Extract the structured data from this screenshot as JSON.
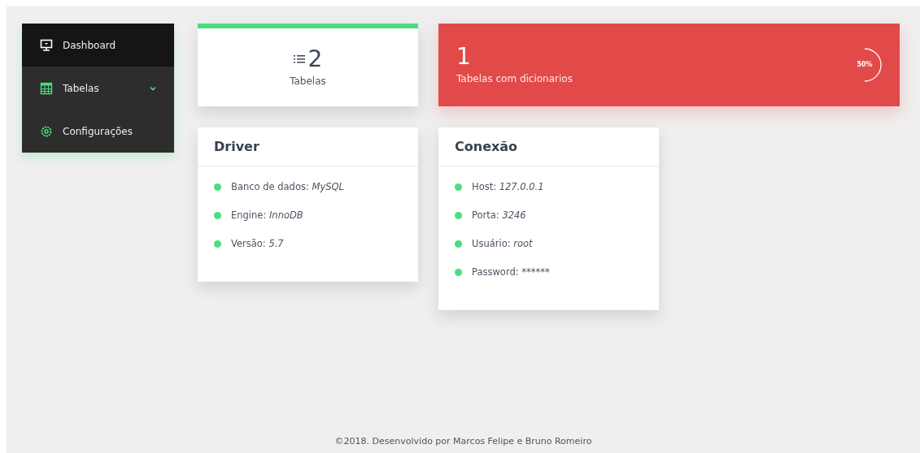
{
  "sidebar": {
    "items": [
      {
        "label": "Dashboard",
        "selected": true
      },
      {
        "label": "Tabelas",
        "selected": false,
        "expanded": true
      },
      {
        "label": "Configurações",
        "selected": false
      }
    ]
  },
  "stats": [
    {
      "kind": "count",
      "value": "2",
      "label": "Tabelas"
    },
    {
      "kind": "progress",
      "value": "1",
      "label": "Tabelas com dicionarios",
      "reading": "50%"
    }
  ],
  "panels": [
    {
      "title": "Driver",
      "items": [
        {
          "label": "Banco de dados:",
          "value": "MySQL"
        },
        {
          "label": "Engine:",
          "value": "InnoDB"
        },
        {
          "label": "Versão:",
          "value": "5.7"
        }
      ]
    },
    {
      "title": "Conexão",
      "items": [
        {
          "label": "Host:",
          "value": "127.0.0.1"
        },
        {
          "label": "Porta:",
          "value": "3246"
        },
        {
          "label": "Usuário:",
          "value": "root"
        },
        {
          "label": "Password:",
          "value": "******"
        }
      ]
    }
  ],
  "footer": "©2018. Desenvolvido por Marcos Felipe e Bruno Romeiro"
}
